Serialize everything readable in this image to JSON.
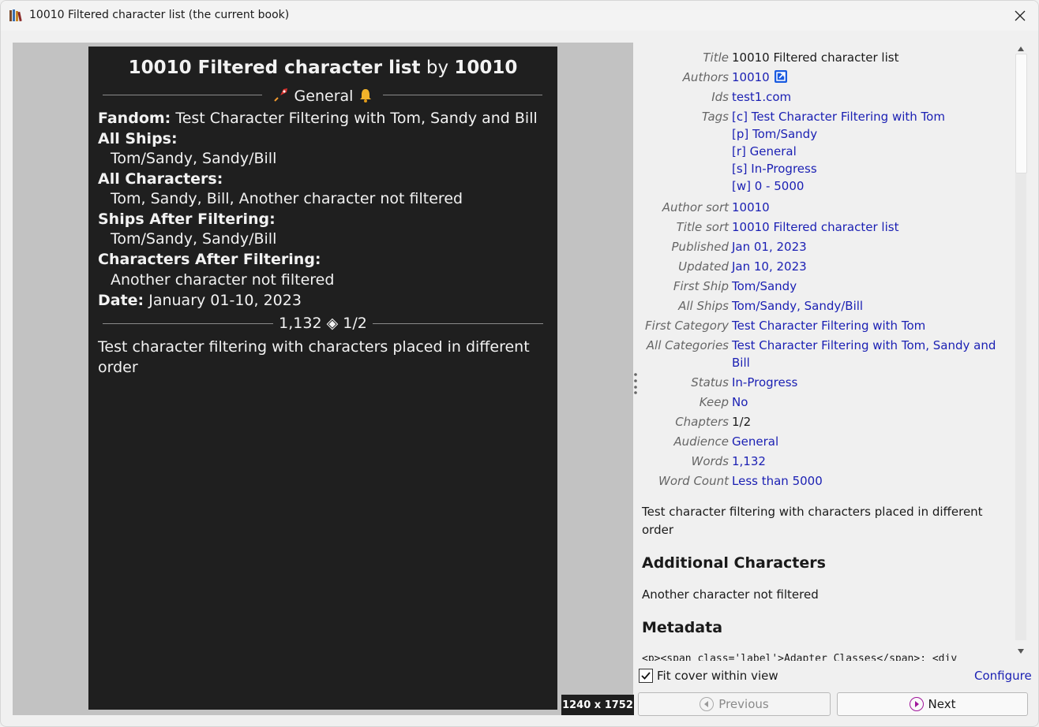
{
  "window": {
    "title": "10010 Filtered character list (the current book)"
  },
  "cover": {
    "title_bold": "10010 Filtered character list",
    "by": "by",
    "author": "10010",
    "rating": "General",
    "fandom_label": "Fandom:",
    "fandom_value": "Test Character Filtering with Tom, Sandy and Bill",
    "all_ships_label": "All Ships:",
    "all_ships_value": "Tom/Sandy, Sandy/Bill",
    "all_characters_label": "All Characters:",
    "all_characters_value": "Tom, Sandy, Bill, Another character not filtered",
    "ships_after_label": "Ships After Filtering:",
    "ships_after_value": "Tom/Sandy, Sandy/Bill",
    "chars_after_label": "Characters After Filtering:",
    "chars_after_value": "Another character not filtered",
    "date_label": "Date:",
    "date_value": "January 01-10, 2023",
    "words": "1,132",
    "chapters": "1/2",
    "summary_line1": "Test character filtering with characters placed in different",
    "summary_line2": "order",
    "dimensions": "1240 x 1752"
  },
  "details": {
    "fields": [
      {
        "label": "Title",
        "value": "10010 Filtered character list"
      },
      {
        "label": "Authors",
        "value": "10010"
      },
      {
        "label": "Ids",
        "value": "test1.com"
      },
      {
        "label": "Tags",
        "values": [
          "[c] Test Character Filtering with Tom",
          "[p] Tom/Sandy",
          "[r] General",
          "[s] In-Progress",
          "[w] 0 - 5000"
        ]
      },
      {
        "label": "Author sort",
        "value": "10010"
      },
      {
        "label": "Title sort",
        "value": "10010 Filtered character list"
      },
      {
        "label": "Published",
        "value": "Jan 01, 2023"
      },
      {
        "label": "Updated",
        "value": "Jan 10, 2023"
      },
      {
        "label": "First Ship",
        "value": "Tom/Sandy"
      },
      {
        "label": "All Ships",
        "value": "Tom/Sandy, Sandy/Bill"
      },
      {
        "label": "First Category",
        "value": "Test Character Filtering with Tom"
      },
      {
        "label": "All Categories",
        "value": "Test Character Filtering with Tom, Sandy and",
        "value2": "Bill"
      },
      {
        "label": "Status",
        "value": "In-Progress"
      },
      {
        "label": "Keep",
        "value": "No"
      },
      {
        "label": "Chapters",
        "value": "1/2"
      },
      {
        "label": "Audience",
        "value": "General"
      },
      {
        "label": "Words",
        "value": "1,132"
      },
      {
        "label": "Word Count",
        "value": "Less than 5000"
      }
    ],
    "description_line1": "Test character filtering with characters placed in different",
    "description_line2": "order",
    "additional_heading": "Additional Characters",
    "additional_text": "Another character not filtered",
    "metadata_heading": "Metadata",
    "metadata_code": "<p><span class='label'>Adapter Classes</span>: <div"
  },
  "controls": {
    "fit_cover_label": "Fit cover within view",
    "fit_cover_checked": true,
    "configure_label": "Configure",
    "previous_label": "Previous",
    "next_label": "Next"
  },
  "icons": {
    "app": "books-icon",
    "close": "close-icon",
    "rating": "rocket-icon",
    "bell": "bell-icon",
    "external": "external-link-icon",
    "prev": "left-arrow-icon",
    "next": "right-arrow-icon"
  }
}
